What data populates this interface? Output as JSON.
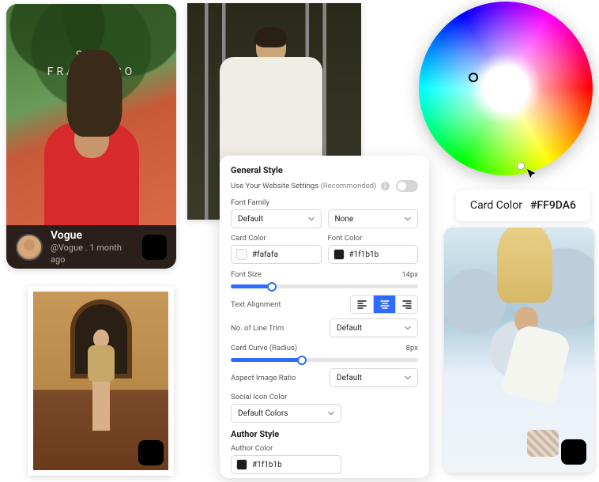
{
  "card1": {
    "overlay_line1": "SAN",
    "overlay_line2": "FRANCISCO",
    "author": "Vogue",
    "handle": "@Vogue",
    "time": "1 month ago",
    "source_icon": "tiktok-icon"
  },
  "card3": {
    "source_icon": "tiktok-icon"
  },
  "card4": {
    "source_icon": "tiktok-icon"
  },
  "colorchip": {
    "label": "Card Color",
    "value": "#FF9DA6"
  },
  "panel": {
    "heading_general": "General Style",
    "use_website": "Use Your Website Settings",
    "recommended": "(Recommonded)",
    "use_website_toggle": false,
    "font_family_label": "Font Family",
    "font_family_value": "Default",
    "font_family_secondary": "None",
    "card_color_label": "Card Color",
    "card_color_value": "#fafafa",
    "font_color_label": "Font Color",
    "font_color_value": "#1f1b1b",
    "font_size_label": "Font Size",
    "font_size_value": "14px",
    "font_size_pct": 22,
    "text_align_label": "Text Alignment",
    "text_align_active": "center",
    "line_trim_label": "No. of Line Trim",
    "line_trim_value": "Default",
    "card_curve_label": "Card Curve (Radius)",
    "card_curve_value": "8px",
    "card_curve_pct": 38,
    "aspect_label": "Aspect Image Ratio",
    "aspect_value": "Default",
    "social_icon_label": "Social Icon Color",
    "social_icon_value": "Default Colors",
    "heading_author": "Author Style",
    "author_color_label": "Author Color",
    "author_color_value": "#1f1b1b"
  }
}
